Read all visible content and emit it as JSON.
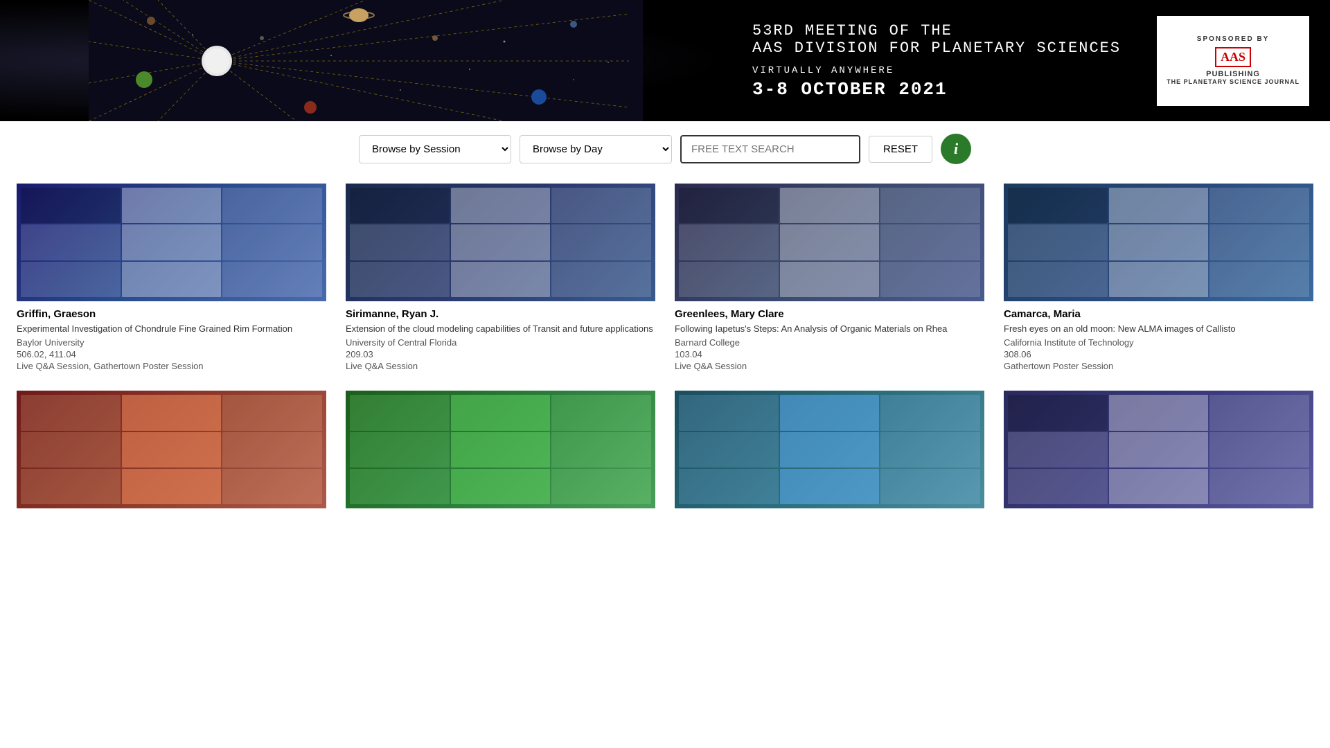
{
  "header": {
    "title_line1": "53RD MEETING OF THE",
    "title_line2": "AAS DIVISION FOR PLANETARY SCIENCES",
    "subtitle": "VIRTUALLY ANYWHERE",
    "dates": "3-8 OCTOBER 2021",
    "sponsor_label": "SPONSORED BY",
    "sponsor_aas": "AAS",
    "sponsor_publishing": "PUBLISHING",
    "sponsor_journal": "THE PLANETARY SCIENCE JOURNAL"
  },
  "controls": {
    "session_dropdown_label": "Browse by Session",
    "day_dropdown_label": "Browse by Day",
    "search_placeholder": "FREE TEXT SEARCH",
    "reset_label": "RESET",
    "info_icon": "i",
    "session_options": [
      "Browse by Session"
    ],
    "day_options": [
      "Browse by Day"
    ]
  },
  "posters": [
    {
      "author": "Griffin, Graeson",
      "title": "Experimental Investigation of Chondrule Fine Grained Rim Formation",
      "institution": "Baylor University",
      "code": "506.02, 411.04",
      "session": "Live Q&A Session, Gathertown Poster Session",
      "thumb_class": "thumb-1"
    },
    {
      "author": "Sirimanne, Ryan J.",
      "title": "Extension of the cloud modeling capabilities of Transit and future applications",
      "institution": "University of Central Florida",
      "code": "209.03",
      "session": "Live Q&A Session",
      "thumb_class": "thumb-2"
    },
    {
      "author": "Greenlees, Mary Clare",
      "title": "Following Iapetus's Steps: An Analysis of Organic Materials on Rhea",
      "institution": "Barnard College",
      "code": "103.04",
      "session": "Live Q&A Session",
      "thumb_class": "thumb-3"
    },
    {
      "author": "Camarca, Maria",
      "title": "Fresh eyes on an old moon: New ALMA images of Callisto",
      "institution": "California Institute of Technology",
      "code": "308.06",
      "session": "Gathertown Poster Session",
      "thumb_class": "thumb-4"
    },
    {
      "author": "",
      "title": "",
      "institution": "",
      "code": "",
      "session": "",
      "thumb_class": "thumb-5"
    },
    {
      "author": "",
      "title": "",
      "institution": "",
      "code": "",
      "session": "",
      "thumb_class": "thumb-6"
    },
    {
      "author": "",
      "title": "",
      "institution": "",
      "code": "",
      "session": "",
      "thumb_class": "thumb-7"
    },
    {
      "author": "",
      "title": "",
      "institution": "",
      "code": "",
      "session": "",
      "thumb_class": "thumb-8"
    }
  ]
}
